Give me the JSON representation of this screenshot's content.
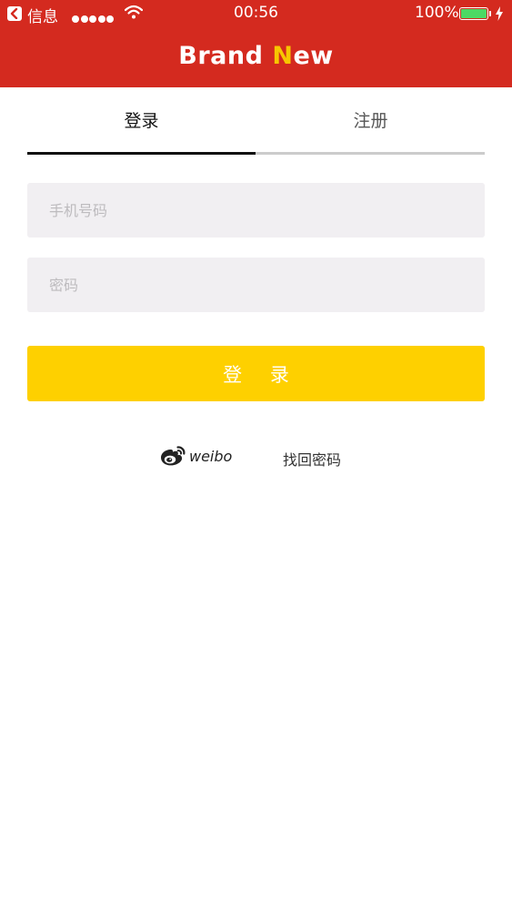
{
  "status_bar": {
    "carrier": "信息",
    "time": "00:56",
    "battery": "100%",
    "signal_bars": 5,
    "battery_color": "#4cd964"
  },
  "header": {
    "brand_first": "Brand ",
    "brand_accent": "N",
    "brand_rest": "ew",
    "background": "#d42a1f",
    "accent_color": "#f7c600"
  },
  "tabs": [
    {
      "label": "登录",
      "active": true
    },
    {
      "label": "注册",
      "active": false
    }
  ],
  "form": {
    "phone_placeholder": "手机号码",
    "password_placeholder": "密码",
    "login_button": "登 录",
    "button_color": "#fed000"
  },
  "links": {
    "weibo": "weibo",
    "forgot_password": "找回密码"
  },
  "icons": {
    "back": "back-arrow-icon",
    "wifi": "wifi-icon",
    "battery": "battery-icon",
    "charging": "bolt-icon",
    "weibo": "weibo-logo-icon"
  }
}
